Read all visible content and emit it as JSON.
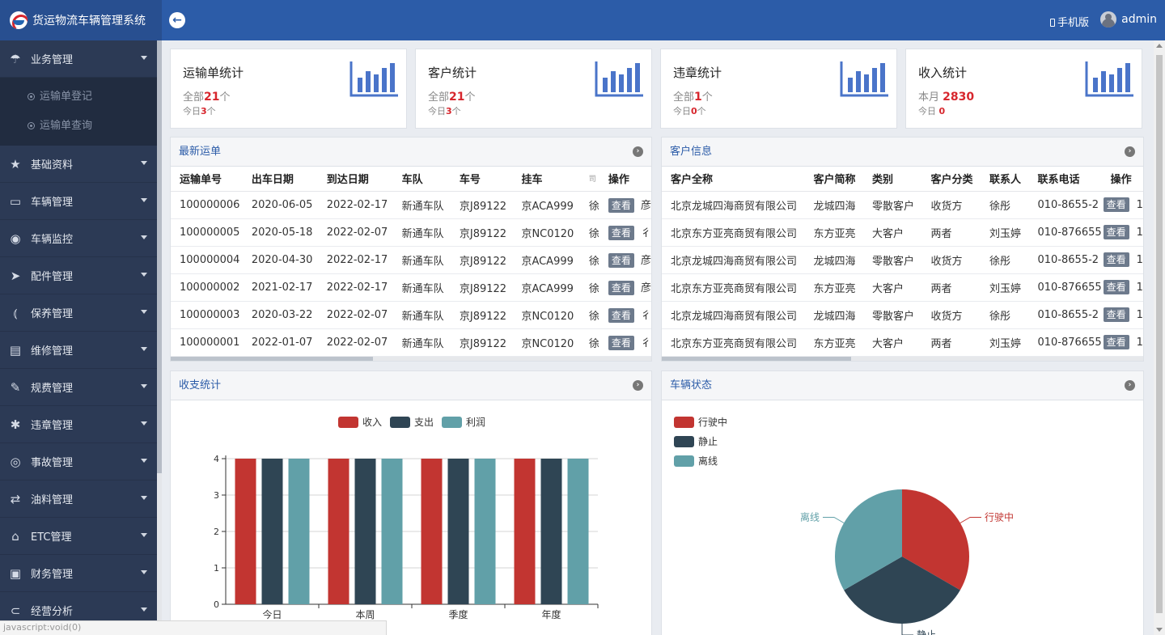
{
  "app": {
    "title": "货运物流车辆管理系统"
  },
  "header": {
    "mobile_label": "手机版",
    "user_name": "admin"
  },
  "sidebar": {
    "items": [
      {
        "label": "业务管理",
        "icon": "umbrella-icon",
        "glyph": "☂"
      },
      {
        "label": "基础资料",
        "icon": "star-icon",
        "glyph": "★"
      },
      {
        "label": "车辆管理",
        "icon": "window-icon",
        "glyph": "▭"
      },
      {
        "label": "车辆监控",
        "icon": "location-pin-icon",
        "glyph": "◉"
      },
      {
        "label": "配件管理",
        "icon": "send-icon",
        "glyph": "➤"
      },
      {
        "label": "保养管理",
        "icon": "signal-icon",
        "glyph": "⦅"
      },
      {
        "label": "维修管理",
        "icon": "document-icon",
        "glyph": "▤"
      },
      {
        "label": "规费管理",
        "icon": "pay-icon",
        "glyph": "✎"
      },
      {
        "label": "违章管理",
        "icon": "asterisk-icon",
        "glyph": "✱"
      },
      {
        "label": "事故管理",
        "icon": "target-icon",
        "glyph": "◎"
      },
      {
        "label": "油料管理",
        "icon": "refresh-icon",
        "glyph": "⇄"
      },
      {
        "label": "ETC管理",
        "icon": "bank-icon",
        "glyph": "⌂"
      },
      {
        "label": "财务管理",
        "icon": "money-icon",
        "glyph": "▣"
      },
      {
        "label": "经营分析",
        "icon": "toggle-icon",
        "glyph": "⊂"
      }
    ],
    "sub_items": [
      {
        "label": "运输单登记"
      },
      {
        "label": "运输单查询"
      }
    ]
  },
  "stats": [
    {
      "title": "运输单统计",
      "line1_prefix": "全部",
      "line1_value": "21",
      "line1_suffix": "个",
      "line2_prefix": "今日",
      "line2_value": "3",
      "line2_suffix": "个"
    },
    {
      "title": "客户统计",
      "line1_prefix": "全部",
      "line1_value": "21",
      "line1_suffix": "个",
      "line2_prefix": "今日",
      "line2_value": "3",
      "line2_suffix": "个"
    },
    {
      "title": "违章统计",
      "line1_prefix": "全部",
      "line1_value": "1",
      "line1_suffix": "个",
      "line2_prefix": "今日",
      "line2_value": "0",
      "line2_suffix": "个"
    },
    {
      "title": "收入统计",
      "line1_prefix": "本月",
      "line1_value": "2830",
      "line1_suffix": "",
      "line2_prefix": "今日",
      "line2_value": "0",
      "line2_suffix": ""
    }
  ],
  "orders": {
    "title": "最新运单",
    "columns": [
      "运输单号",
      "出车日期",
      "到达日期",
      "车队",
      "车号",
      "挂车",
      "司",
      "操作"
    ],
    "action_label": "查看",
    "rows": [
      {
        "no": "100000006",
        "out": "2020-06-05",
        "arrive": "2022-02-17",
        "team": "新通车队",
        "car": "京J89122",
        "trailer": "京ACA999",
        "driver": "徐",
        "tail": "彦"
      },
      {
        "no": "100000005",
        "out": "2020-05-18",
        "arrive": "2022-02-07",
        "team": "新通车队",
        "car": "京J89122",
        "trailer": "京NC0120",
        "driver": "徐",
        "tail": "彳"
      },
      {
        "no": "100000004",
        "out": "2020-04-30",
        "arrive": "2022-02-17",
        "team": "新通车队",
        "car": "京J89122",
        "trailer": "京ACA999",
        "driver": "徐",
        "tail": "彦"
      },
      {
        "no": "100000002",
        "out": "2021-02-17",
        "arrive": "2022-02-17",
        "team": "新通车队",
        "car": "京J89122",
        "trailer": "京ACA999",
        "driver": "徐",
        "tail": "彦"
      },
      {
        "no": "100000003",
        "out": "2020-03-22",
        "arrive": "2022-02-07",
        "team": "新通车队",
        "car": "京J89122",
        "trailer": "京NC0120",
        "driver": "徐",
        "tail": "彳"
      },
      {
        "no": "100000001",
        "out": "2022-01-07",
        "arrive": "2022-02-07",
        "team": "新通车队",
        "car": "京J89122",
        "trailer": "京NC0120",
        "driver": "徐",
        "tail": "彳"
      }
    ]
  },
  "customers": {
    "title": "客户信息",
    "columns": [
      "客户全称",
      "客户简称",
      "类别",
      "客户分类",
      "联系人",
      "联系电话",
      "操作"
    ],
    "action_label": "查看",
    "rows": [
      {
        "name": "北京龙城四海商贸有限公司",
        "short": "龙城四海",
        "type": "零散客户",
        "cls": "收货方",
        "contact": "徐彤",
        "phone": "010-8655-2",
        "tail": "1"
      },
      {
        "name": "北京东方亚亮商贸有限公司",
        "short": "东方亚亮",
        "type": "大客户",
        "cls": "两者",
        "contact": "刘玉婷",
        "phone": "010-876655",
        "tail": "1"
      },
      {
        "name": "北京龙城四海商贸有限公司",
        "short": "龙城四海",
        "type": "零散客户",
        "cls": "收货方",
        "contact": "徐彤",
        "phone": "010-8655-2",
        "tail": "1"
      },
      {
        "name": "北京东方亚亮商贸有限公司",
        "short": "东方亚亮",
        "type": "大客户",
        "cls": "两者",
        "contact": "刘玉婷",
        "phone": "010-876655",
        "tail": "1"
      },
      {
        "name": "北京龙城四海商贸有限公司",
        "short": "龙城四海",
        "type": "零散客户",
        "cls": "收货方",
        "contact": "徐彤",
        "phone": "010-8655-2",
        "tail": "1"
      },
      {
        "name": "北京东方亚亮商贸有限公司",
        "short": "东方亚亮",
        "type": "大客户",
        "cls": "两者",
        "contact": "刘玉婷",
        "phone": "010-876655",
        "tail": "1"
      }
    ]
  },
  "finance_panel": {
    "title": "收支统计"
  },
  "vehicle_panel": {
    "title": "车辆状态"
  },
  "status_bar": {
    "text": "javascript:void(0)"
  },
  "colors": {
    "header": "#2c5ca8",
    "sidebar": "#2c3a55",
    "red": "#c23531",
    "dark": "#2f4554",
    "teal": "#61a0a8",
    "accent": "#d7262d"
  },
  "chart_data": [
    {
      "type": "bar",
      "categories": [
        "今日",
        "本周",
        "季度",
        "年度"
      ],
      "series": [
        {
          "name": "收入",
          "values": [
            4,
            4,
            4,
            4
          ],
          "color": "#c23531"
        },
        {
          "name": "支出",
          "values": [
            4,
            4,
            4,
            4
          ],
          "color": "#2f4554"
        },
        {
          "name": "利润",
          "values": [
            4,
            4,
            4,
            4
          ],
          "color": "#61a0a8"
        }
      ],
      "yticks": [
        "0",
        "1",
        "2",
        "3",
        "4"
      ],
      "ylim": [
        0,
        4
      ],
      "legend": "top-center",
      "grid": true
    },
    {
      "type": "pie",
      "labels": [
        "行驶中",
        "静止",
        "离线"
      ],
      "values": [
        1,
        1,
        1
      ],
      "colors": [
        "#c23531",
        "#2f4554",
        "#61a0a8"
      ],
      "legend": "top-left"
    }
  ]
}
